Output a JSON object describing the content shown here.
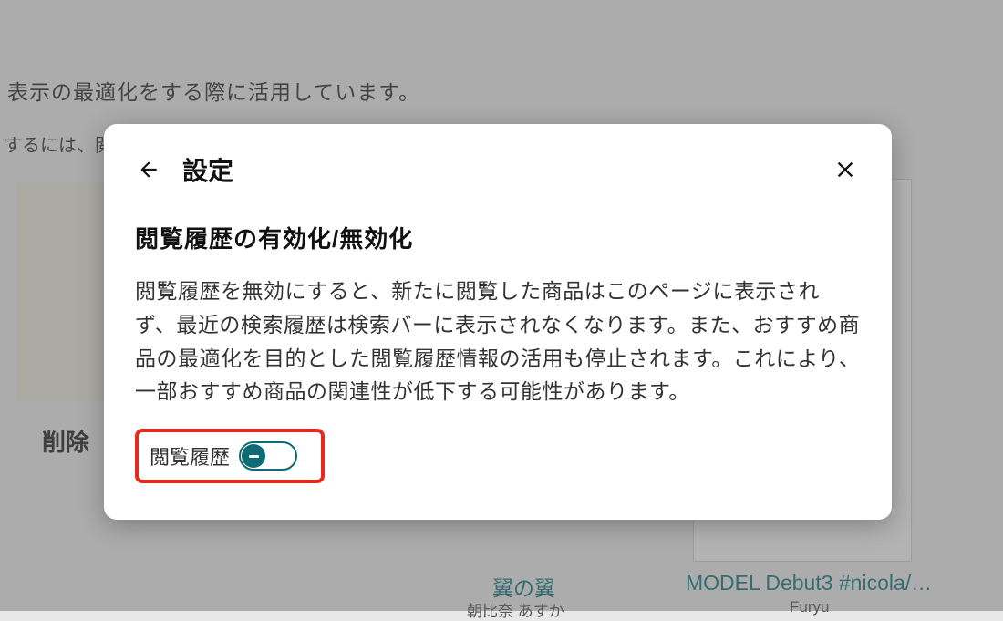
{
  "background": {
    "partial_text_1": "表示の最適化をする際に活用しています。",
    "partial_text_2": "するには、閲",
    "delete_text": "削除",
    "product_1": {
      "title": "翼の翼",
      "sub": "朝比奈 あすか"
    },
    "product_2": {
      "title": "MODEL Debut3 #nicola/…",
      "sub": "Furyu"
    }
  },
  "modal": {
    "title": "設定",
    "section_title": "閲覧履歴の有効化/無効化",
    "body": "閲覧履歴を無効にすると、新たに閲覧した商品はこのページに表示されず、最近の検索履歴は検索バーに表示されなくなります。また、おすすめ商品の最適化を目的とした閲覧履歴情報の活用も停止されます。これにより、一部おすすめ商品の関連性が低下する可能性があります。",
    "toggle_label": "閲覧履歴",
    "toggle_state": "off",
    "highlight_color": "#e82a1a",
    "accent_color": "#0f6b73"
  }
}
